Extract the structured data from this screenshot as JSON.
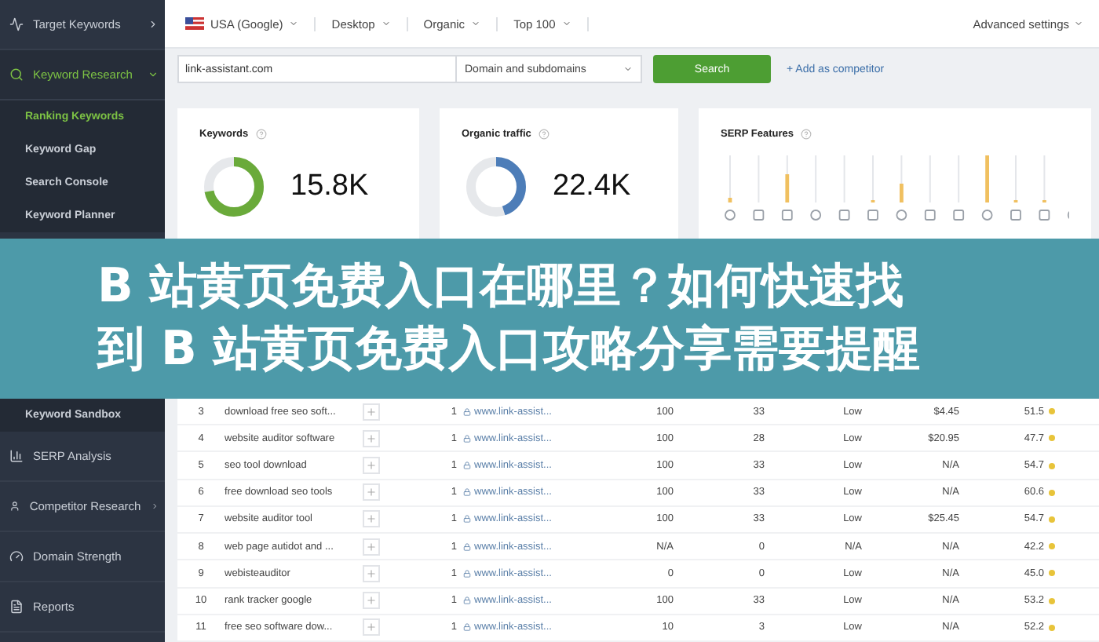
{
  "sidebar": {
    "upper_items": [
      {
        "label": "Target Keywords",
        "kind": "group",
        "expanded": false,
        "selected": false
      },
      {
        "label": "Keyword Research",
        "kind": "group",
        "expanded": true,
        "selected": true
      },
      {
        "label": "Ranking Keywords",
        "kind": "sub",
        "selected": true
      },
      {
        "label": "Keyword Gap",
        "kind": "sub",
        "selected": false
      },
      {
        "label": "Search Console",
        "kind": "sub",
        "selected": false
      },
      {
        "label": "Keyword Planner",
        "kind": "sub",
        "selected": false
      }
    ],
    "lower_items": [
      {
        "label": "Keyword Sandbox",
        "kind": "sub",
        "selected": false
      },
      {
        "label": "SERP Analysis",
        "kind": "link",
        "selected": false
      },
      {
        "label": "Competitor Research",
        "kind": "group",
        "expanded": false,
        "selected": false
      },
      {
        "label": "Domain Strength",
        "kind": "link",
        "selected": false
      },
      {
        "label": "Reports",
        "kind": "link",
        "selected": false
      }
    ]
  },
  "filters": [
    "USA (Google)",
    "Desktop",
    "Organic",
    "Top 100"
  ],
  "advanced_settings": "Advanced settings",
  "domain_field": {
    "value": "link-assistant.com"
  },
  "scope_select": {
    "value": "Domain and subdomains"
  },
  "search_button": "Search",
  "add_competitor_link": "+ Add as competitor",
  "cards": [
    {
      "title": "Keywords",
      "value": "15.8K",
      "level": 0.72,
      "color": "#6aaa3a"
    },
    {
      "title": "Organic traffic",
      "value": "22.4K",
      "level": 0.45,
      "color": "#4d7db8"
    }
  ],
  "serp_card": {
    "title": "SERP Features"
  },
  "banner": {
    "lines": [
      "B 站黄页免费入口在哪里？如何快速找",
      "到 B 站黄页免费入口攻略分享需要提醒"
    ]
  },
  "table": {
    "rows": [
      {
        "number": "3",
        "keyword": "download free seo soft...",
        "rank": "1",
        "url": "www.link-assist...",
        "searches": "100",
        "organic_traffic": "33",
        "competition": "Low",
        "cost_per_click": "$4.45",
        "keyword_difficulty": "51.5"
      },
      {
        "number": "4",
        "keyword": "website auditor software",
        "rank": "1",
        "url": "www.link-assist...",
        "searches": "100",
        "organic_traffic": "28",
        "competition": "Low",
        "cost_per_click": "$20.95",
        "keyword_difficulty": "47.7"
      },
      {
        "number": "5",
        "keyword": "seo tool download",
        "rank": "1",
        "url": "www.link-assist...",
        "searches": "100",
        "organic_traffic": "33",
        "competition": "Low",
        "cost_per_click": "N/A",
        "keyword_difficulty": "54.7"
      },
      {
        "number": "6",
        "keyword": "free download seo tools",
        "rank": "1",
        "url": "www.link-assist...",
        "searches": "100",
        "organic_traffic": "33",
        "competition": "Low",
        "cost_per_click": "N/A",
        "keyword_difficulty": "60.6"
      },
      {
        "number": "7",
        "keyword": "website auditor tool",
        "rank": "1",
        "url": "www.link-assist...",
        "searches": "100",
        "organic_traffic": "33",
        "competition": "Low",
        "cost_per_click": "$25.45",
        "keyword_difficulty": "54.7"
      },
      {
        "number": "8",
        "keyword": "web page autidot and ...",
        "rank": "1",
        "url": "www.link-assist...",
        "searches": "N/A",
        "organic_traffic": "0",
        "competition": "N/A",
        "cost_per_click": "N/A",
        "keyword_difficulty": "42.2"
      },
      {
        "number": "9",
        "keyword": "webisteauditor",
        "rank": "1",
        "url": "www.link-assist...",
        "searches": "0",
        "organic_traffic": "0",
        "competition": "Low",
        "cost_per_click": "N/A",
        "keyword_difficulty": "45.0"
      },
      {
        "number": "10",
        "keyword": "rank tracker google",
        "rank": "1",
        "url": "www.link-assist...",
        "searches": "100",
        "organic_traffic": "33",
        "competition": "Low",
        "cost_per_click": "N/A",
        "keyword_difficulty": "53.2"
      },
      {
        "number": "11",
        "keyword": "free seo software dow...",
        "rank": "1",
        "url": "www.link-assist...",
        "searches": "10",
        "organic_traffic": "3",
        "competition": "Low",
        "cost_per_click": "N/A",
        "keyword_difficulty": "52.2"
      }
    ]
  }
}
